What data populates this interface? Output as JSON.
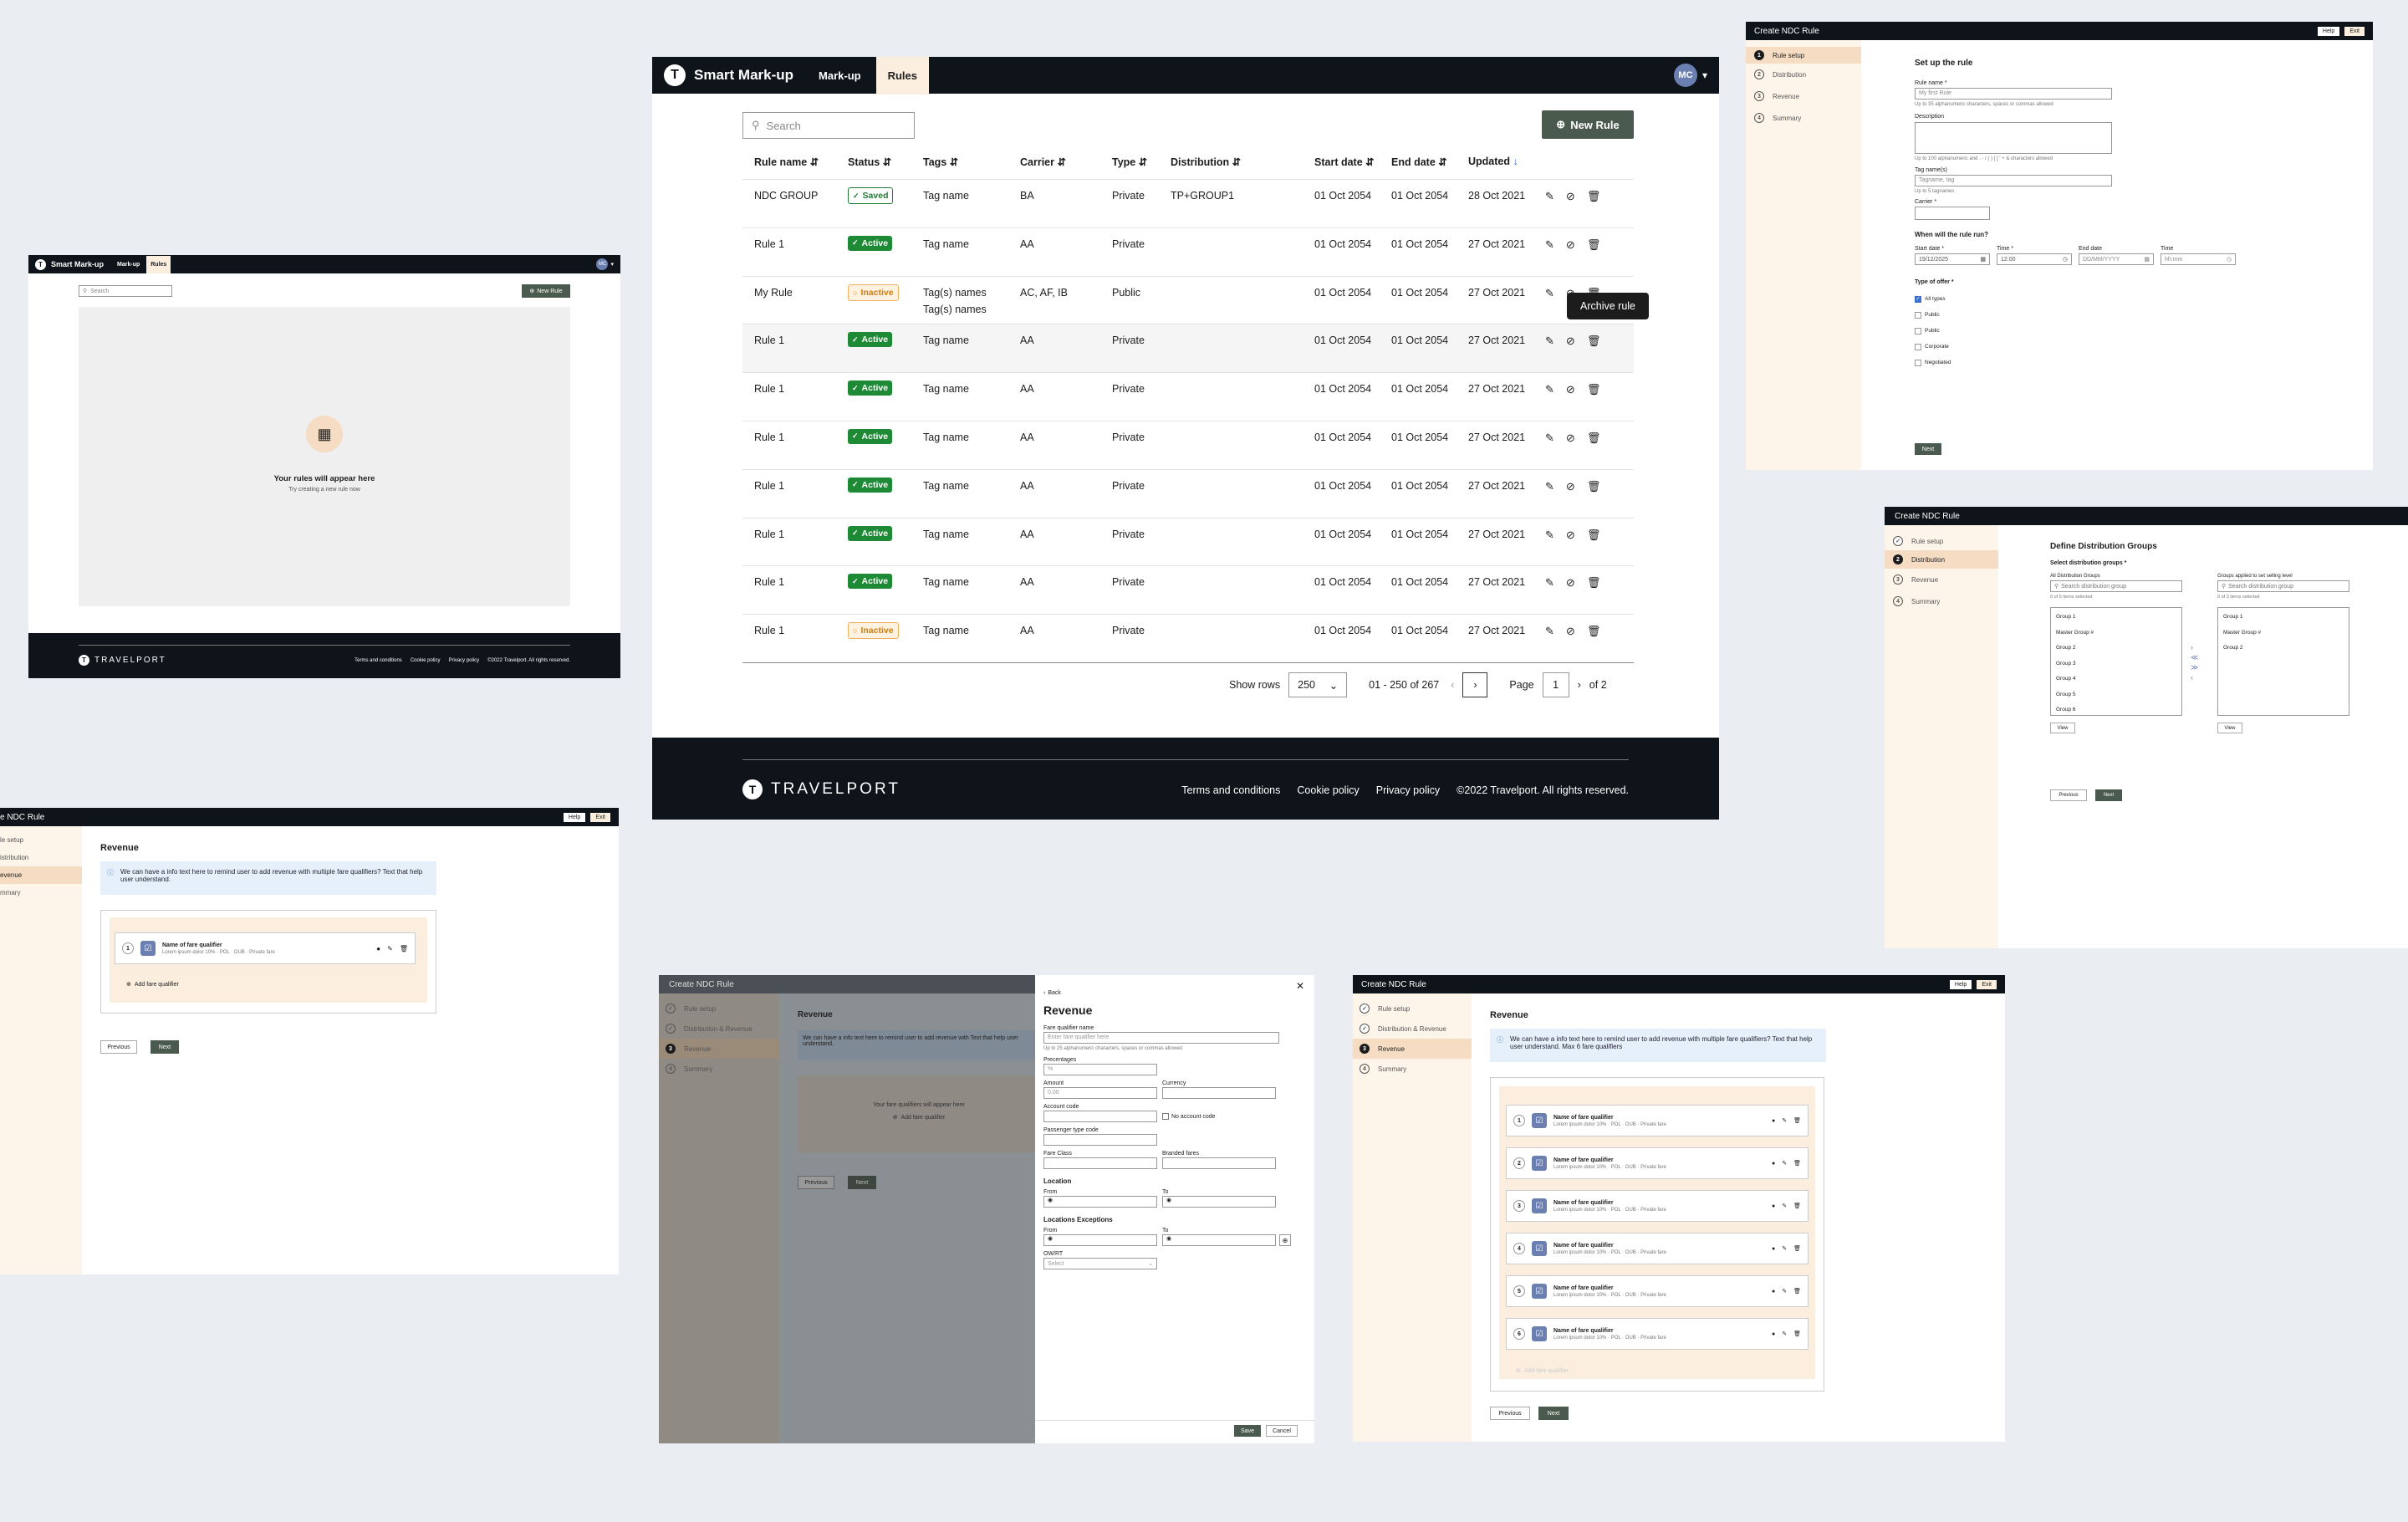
{
  "main": {
    "app_title": "Smart Mark-up",
    "nav": [
      "Mark-up",
      "Rules"
    ],
    "avatar": "MC",
    "search_placeholder": "Search",
    "new_rule": "New Rule",
    "columns": [
      "Rule name",
      "Status",
      "Tags",
      "Carrier",
      "Type",
      "Distribution",
      "Start date",
      "End date",
      "Updated"
    ],
    "rows": [
      {
        "name": "NDC GROUP",
        "status": "Saved",
        "tags": "Tag name",
        "tags2": "",
        "carrier": "BA",
        "type": "Private",
        "dist": "TP+GROUP1",
        "start": "01 Oct 2054",
        "end": "01 Oct 2054",
        "updated": "28 Oct 2021"
      },
      {
        "name": "Rule 1",
        "status": "Active",
        "tags": "Tag name",
        "tags2": "",
        "carrier": "AA",
        "type": "Private",
        "dist": "",
        "start": "01 Oct 2054",
        "end": "01 Oct 2054",
        "updated": "27 Oct 2021"
      },
      {
        "name": "My Rule",
        "status": "Inactive",
        "tags": "Tag(s) names",
        "tags2": "Tag(s) names",
        "carrier": "AC, AF, IB",
        "type": "Public",
        "dist": "",
        "start": "01 Oct 2054",
        "end": "01 Oct 2054",
        "updated": "27 Oct 2021"
      },
      {
        "name": "Rule 1",
        "status": "Active",
        "tags": "Tag name",
        "tags2": "",
        "carrier": "AA",
        "type": "Private",
        "dist": "",
        "start": "01 Oct 2054",
        "end": "01 Oct 2054",
        "updated": "27 Oct 2021"
      },
      {
        "name": "Rule 1",
        "status": "Active",
        "tags": "Tag name",
        "tags2": "",
        "carrier": "AA",
        "type": "Private",
        "dist": "",
        "start": "01 Oct 2054",
        "end": "01 Oct 2054",
        "updated": "27 Oct 2021"
      },
      {
        "name": "Rule 1",
        "status": "Active",
        "tags": "Tag name",
        "tags2": "",
        "carrier": "AA",
        "type": "Private",
        "dist": "",
        "start": "01 Oct 2054",
        "end": "01 Oct 2054",
        "updated": "27 Oct 2021"
      },
      {
        "name": "Rule 1",
        "status": "Active",
        "tags": "Tag name",
        "tags2": "",
        "carrier": "AA",
        "type": "Private",
        "dist": "",
        "start": "01 Oct 2054",
        "end": "01 Oct 2054",
        "updated": "27 Oct 2021"
      },
      {
        "name": "Rule 1",
        "status": "Active",
        "tags": "Tag name",
        "tags2": "",
        "carrier": "AA",
        "type": "Private",
        "dist": "",
        "start": "01 Oct 2054",
        "end": "01 Oct 2054",
        "updated": "27 Oct 2021"
      },
      {
        "name": "Rule 1",
        "status": "Active",
        "tags": "Tag name",
        "tags2": "",
        "carrier": "AA",
        "type": "Private",
        "dist": "",
        "start": "01 Oct 2054",
        "end": "01 Oct 2054",
        "updated": "27 Oct 2021"
      },
      {
        "name": "Rule 1",
        "status": "Inactive",
        "tags": "Tag name",
        "tags2": "",
        "carrier": "AA",
        "type": "Private",
        "dist": "",
        "start": "01 Oct 2054",
        "end": "01 Oct 2054",
        "updated": "27 Oct 2021"
      }
    ],
    "tooltip": "Archive rule",
    "show_rows_label": "Show rows",
    "show_rows_value": "250",
    "range": "01 - 250 of 267",
    "page_label": "Page",
    "page_value": "1",
    "page_total": "of 2",
    "brand": "TRAVELPORT",
    "footer_links": [
      "Terms and conditions",
      "Cookie policy",
      "Privacy policy"
    ],
    "copyright": "©2022 Travelport. All rights reserved."
  },
  "empty": {
    "app_title": "Smart Mark-up",
    "nav": [
      "Mark-up",
      "Rules"
    ],
    "avatar": "MC",
    "search_placeholder": "Search",
    "new_rule": "New Rule",
    "empty_title": "Your rules will appear here",
    "empty_sub": "Try creating a new rule now",
    "brand": "TRAVELPORT",
    "footer_links": [
      "Terms and conditions",
      "Cookie policy",
      "Privacy policy"
    ],
    "copyright": "©2022 Travelport. All rights reserved."
  },
  "setup": {
    "title": "Create NDC Rule",
    "help": "Help",
    "exit": "Exit",
    "steps": [
      "Rule setup",
      "Distribution",
      "Revenue",
      "Summary"
    ],
    "heading": "Set up the rule",
    "rule_name_label": "Rule name *",
    "rule_name_value": "My first Rule",
    "rule_name_hint": "Up to 35 alphanumeric characters, spaces or commas allowed",
    "desc_label": "Description",
    "desc_hint": "Up to 100 alphanumeric and . - / ( ) [ ] ' + & characters allowed",
    "tags_label": "Tag name(s)",
    "tags_placeholder": "Tagname, tag",
    "tags_hint": "Up to 5 tagnames",
    "carrier_label": "Carrier *",
    "when_heading": "When will the rule run?",
    "start_label": "Start date *",
    "start_value": "19/12/2025",
    "time_label": "Time *",
    "time_value": "12:00",
    "end_label": "End date",
    "end_placeholder": "DD/MM/YYYY",
    "time2_label": "Time",
    "time2_placeholder": "hh:mm",
    "offer_heading": "Type of offer *",
    "offers": [
      "All types",
      "Public",
      "Public",
      "Corporate",
      "Negotiated"
    ],
    "next": "Next"
  },
  "distribution": {
    "title": "Create NDC Rule",
    "steps": [
      "Rule setup",
      "Distribution",
      "Revenue",
      "Summary"
    ],
    "heading": "Define Distribution Groups",
    "sub": "Select distribution groups *",
    "all_label": "All Distribution Groups",
    "applied_label": "Groups applied to set selling level",
    "search_placeholder": "Search distribution group",
    "all_count": "0 of 5 items selected",
    "applied_count": "0 of 3 items selected",
    "left_items": [
      "Group 1",
      "Master Group #",
      "Group 2",
      "Group 3",
      "Group 4",
      "Group 5",
      "Group 6"
    ],
    "right_items": [
      "Group 1",
      "Master Group #",
      "Group 2"
    ],
    "view": "View",
    "previous": "Previous",
    "next": "Next"
  },
  "revenue_one": {
    "title": "e NDC Rule",
    "help": "Help",
    "exit": "Exit",
    "steps": [
      "le setup",
      "istribution",
      "evenue",
      "mmary"
    ],
    "heading": "Revenue",
    "info": "We can have a info text here to remind user to add revenue with multiple fare qualifiers? Text that help user understand.",
    "qual_num": "1",
    "qual_name": "Name of fare qualifier",
    "qual_desc": "Lorem ipsum dolor 10% · POL · OUB · Private fare",
    "add": "Add fare qualifier",
    "previous": "Previous",
    "next": "Next"
  },
  "revenue_drawer": {
    "title": "Create NDC Rule",
    "steps": [
      "Rule setup",
      "Distribution & Revenue",
      "Revenue",
      "Summary"
    ],
    "heading": "Revenue",
    "info": "We can have a info text here to remind user to add revenue with Text that help user understand.",
    "empty_note": "Your fare qualifiers will appear here",
    "add": "Add fare qualifier",
    "previous": "Previous",
    "next": "Next",
    "back": "Back",
    "drawer_title": "Revenue",
    "fq_label": "Fare qualifier name",
    "fq_placeholder": "Enter fare qualifier here",
    "fq_hint": "Up to 25 alphanumeric characters, spaces or commas allowed.",
    "pct_label": "Precentages",
    "pct_placeholder": "%",
    "amount_label": "Amount",
    "amount_placeholder": "0.00",
    "currency_label": "Currency",
    "account_label": "Account code",
    "no_account": "No account code",
    "ptc_label": "Passenger type code",
    "fare_class_label": "Fare Class",
    "branded_label": "Branded fares",
    "location_heading": "Location",
    "from_label": "From",
    "to_label": "To",
    "exceptions_heading": "Locations Exceptions",
    "onrt_label": "OW/RT",
    "select_placeholder": "Select",
    "save": "Save",
    "cancel": "Cancel"
  },
  "revenue_many": {
    "title": "Create NDC Rule",
    "help": "Help",
    "exit": "Exit",
    "steps": [
      "Rule setup",
      "Distribution & Revenue",
      "Revenue",
      "Summary"
    ],
    "heading": "Revenue",
    "info": "We can have a info text here to remind user to add revenue with multiple fare qualifiers? Text that help user understand. Max 6 fare qualifiers",
    "qual_nums": [
      "1",
      "2",
      "3",
      "4",
      "5",
      "6"
    ],
    "qual_name": "Name of fare qualifier",
    "qual_desc": "Lorem ipsum dolor 10% · POL · OUB · Private fare",
    "add": "Add fare qualifier",
    "previous": "Previous",
    "next": "Next"
  }
}
